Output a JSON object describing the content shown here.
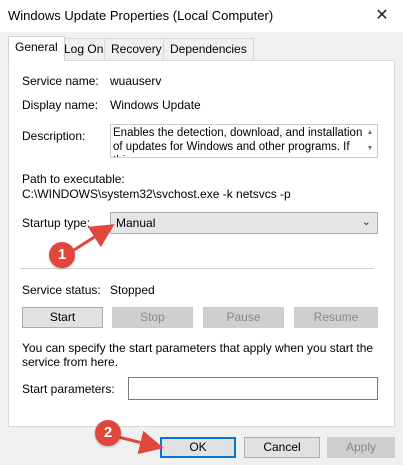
{
  "window": {
    "title": "Windows Update Properties (Local Computer)",
    "close_glyph": "✕"
  },
  "tabs": [
    "General",
    "Log On",
    "Recovery",
    "Dependencies"
  ],
  "general": {
    "service_name_label": "Service name:",
    "service_name_value": "wuauserv",
    "display_name_label": "Display name:",
    "display_name_value": "Windows Update",
    "description_label": "Description:",
    "description_value": "Enables the detection, download, and installation of updates for Windows and other programs. If this",
    "path_label": "Path to executable:",
    "path_value": "C:\\WINDOWS\\system32\\svchost.exe -k netsvcs -p",
    "startup_type_label": "Startup type:",
    "startup_type_value": "Manual",
    "service_status_label": "Service status:",
    "service_status_value": "Stopped",
    "buttons": {
      "start": "Start",
      "stop": "Stop",
      "pause": "Pause",
      "resume": "Resume"
    },
    "info_text": "You can specify the start parameters that apply when you start the service from here.",
    "start_params_label": "Start parameters:",
    "start_params_value": ""
  },
  "footer": {
    "ok": "OK",
    "cancel": "Cancel",
    "apply": "Apply"
  },
  "annotations": {
    "marker1": "1",
    "marker2": "2"
  },
  "colors": {
    "marker": "#e0463b",
    "focus": "#0078d7"
  }
}
